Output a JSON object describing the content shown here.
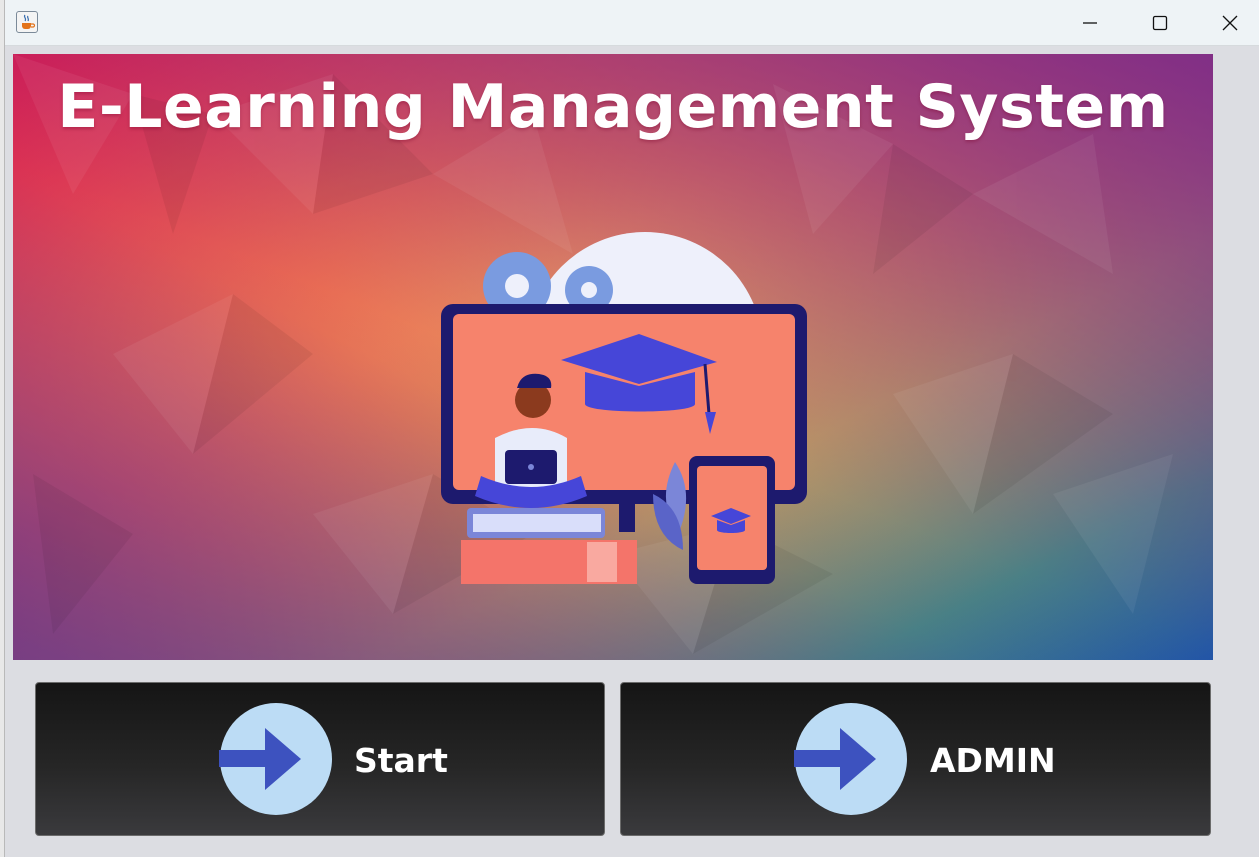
{
  "window": {
    "title": "",
    "controls": {
      "minimize": "minimize",
      "maximize": "maximize",
      "close": "close"
    }
  },
  "banner": {
    "title": "E-Learning Management System",
    "illustration": "student-laptop-graduation-cap-illustration"
  },
  "buttons": {
    "start_label": "Start",
    "admin_label": "ADMIN"
  },
  "icons": {
    "app": "java-cup-icon",
    "start": "arrow-right-circle-icon",
    "admin": "arrow-right-circle-icon"
  },
  "colors": {
    "button_bg": "#1f1f1f",
    "icon_circle": "#bcdcf5",
    "icon_arrow": "#3d52bf",
    "title_text": "#ffffff"
  }
}
